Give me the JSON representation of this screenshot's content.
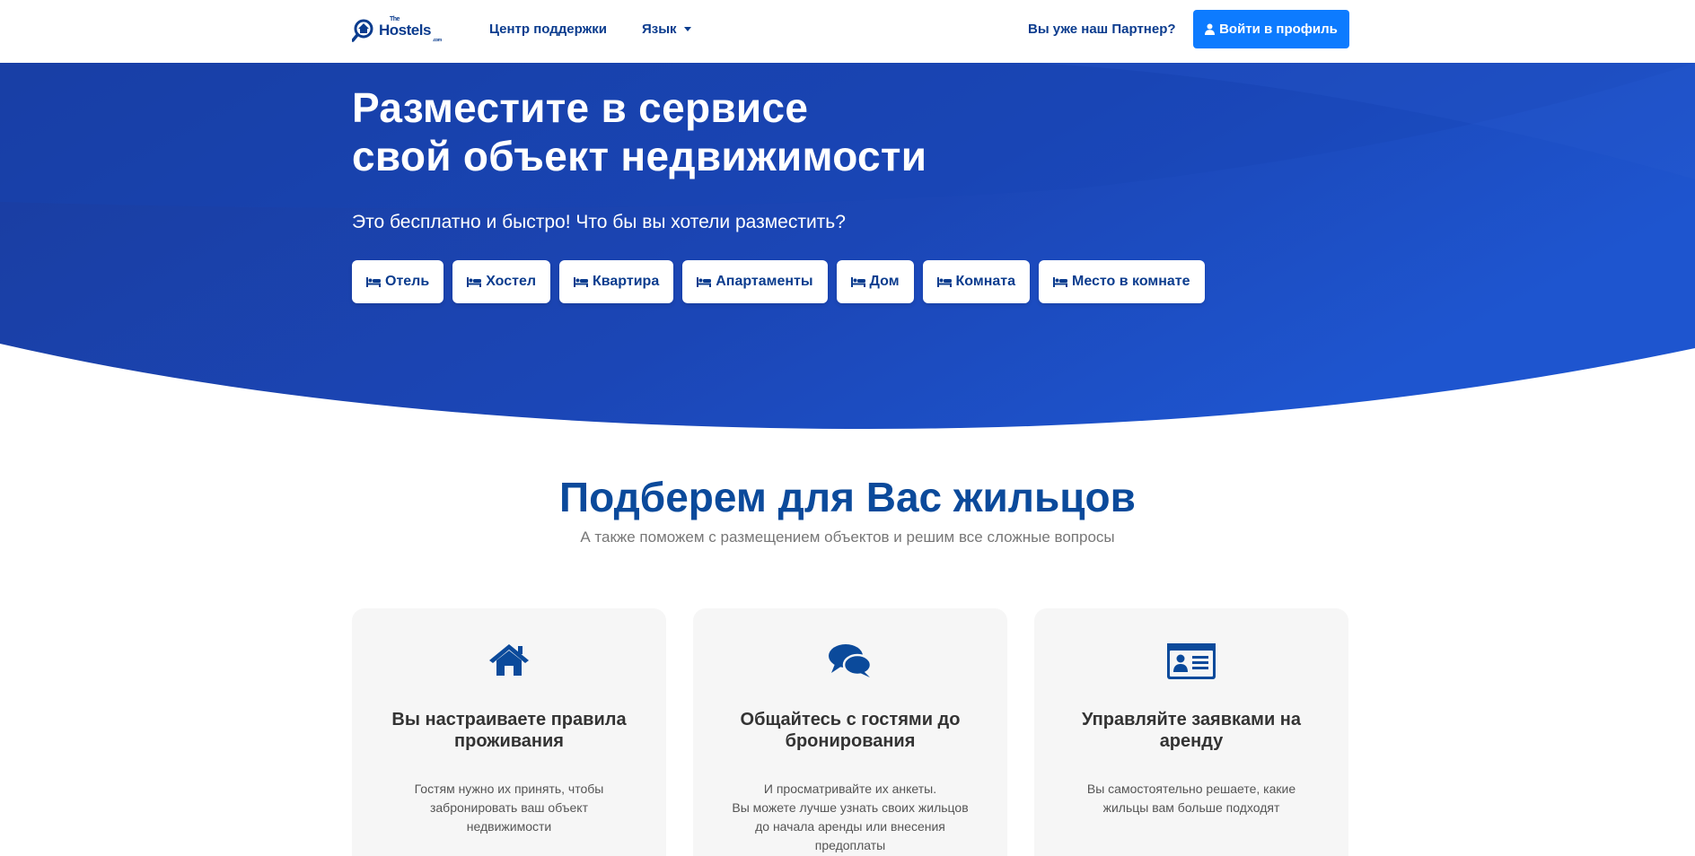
{
  "header": {
    "logo": {
      "top": "The",
      "main": "Hostels",
      "suffix": ".com"
    },
    "nav": {
      "support": "Центр поддержки",
      "language": "Язык"
    },
    "partner_question": "Вы уже наш Партнер?",
    "login_button": "Войти в профиль"
  },
  "hero": {
    "title_line1": "Разместите в сервисе",
    "title_line2": "свой объект недвижимости",
    "subtitle": "Это бесплатно и быстро! Что бы вы хотели разместить?",
    "property_types": [
      "Отель",
      "Хостел",
      "Квартира",
      "Апартаменты",
      "Дом",
      "Комната",
      "Место в комнате"
    ]
  },
  "features": {
    "title": "Подберем для Вас жильцов",
    "subtitle": "А также поможем с размещением объектов и решим все сложные вопросы",
    "cards": [
      {
        "icon": "home-icon",
        "title": "Вы настраиваете правила проживания",
        "text": "Гостям нужно их принять, чтобы забронировать ваш объект недвижимости"
      },
      {
        "icon": "chat-icon",
        "title": "Общайтесь с гостями до бронирования",
        "text": "И просматривайте их анкеты.\nВы можете лучше узнать своих жильцов до начала аренды или внесения предоплаты"
      },
      {
        "icon": "id-card-icon",
        "title": "Управляйте заявками на аренду",
        "text": "Вы самостоятельно решаете, какие жильцы вам больше подходят"
      }
    ]
  },
  "colors": {
    "brand_dark": "#0b3c8e",
    "hero_blue": "#1b46b8",
    "accent": "#0d7bff",
    "card_bg": "#f6f6f6"
  }
}
